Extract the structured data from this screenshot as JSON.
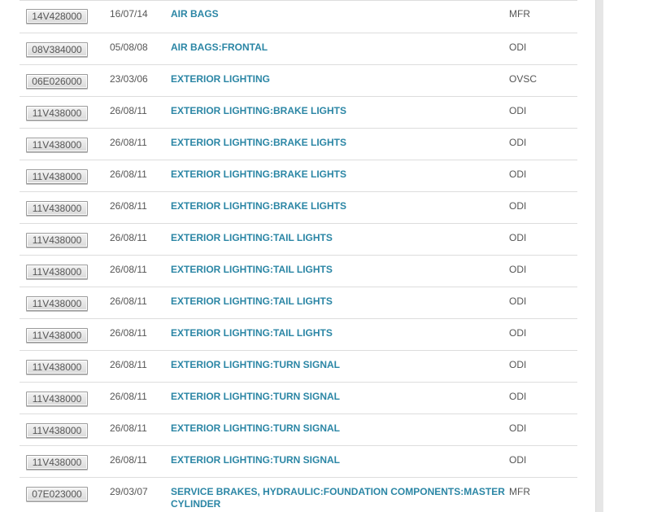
{
  "recalls": [
    {
      "id": "14V428000",
      "date": "16/07/14",
      "component": "AIR BAGS",
      "source": "MFR"
    },
    {
      "id": "08V384000",
      "date": "05/08/08",
      "component": "AIR BAGS:FRONTAL",
      "source": "ODI"
    },
    {
      "id": "06E026000",
      "date": "23/03/06",
      "component": "EXTERIOR LIGHTING",
      "source": "OVSC"
    },
    {
      "id": "11V438000",
      "date": "26/08/11",
      "component": "EXTERIOR LIGHTING:BRAKE LIGHTS",
      "source": "ODI"
    },
    {
      "id": "11V438000",
      "date": "26/08/11",
      "component": "EXTERIOR LIGHTING:BRAKE LIGHTS",
      "source": "ODI"
    },
    {
      "id": "11V438000",
      "date": "26/08/11",
      "component": "EXTERIOR LIGHTING:BRAKE LIGHTS",
      "source": "ODI"
    },
    {
      "id": "11V438000",
      "date": "26/08/11",
      "component": "EXTERIOR LIGHTING:BRAKE LIGHTS",
      "source": "ODI"
    },
    {
      "id": "11V438000",
      "date": "26/08/11",
      "component": "EXTERIOR LIGHTING:TAIL LIGHTS",
      "source": "ODI"
    },
    {
      "id": "11V438000",
      "date": "26/08/11",
      "component": "EXTERIOR LIGHTING:TAIL LIGHTS",
      "source": "ODI"
    },
    {
      "id": "11V438000",
      "date": "26/08/11",
      "component": "EXTERIOR LIGHTING:TAIL LIGHTS",
      "source": "ODI"
    },
    {
      "id": "11V438000",
      "date": "26/08/11",
      "component": "EXTERIOR LIGHTING:TAIL LIGHTS",
      "source": "ODI"
    },
    {
      "id": "11V438000",
      "date": "26/08/11",
      "component": "EXTERIOR LIGHTING:TURN SIGNAL",
      "source": "ODI"
    },
    {
      "id": "11V438000",
      "date": "26/08/11",
      "component": "EXTERIOR LIGHTING:TURN SIGNAL",
      "source": "ODI"
    },
    {
      "id": "11V438000",
      "date": "26/08/11",
      "component": "EXTERIOR LIGHTING:TURN SIGNAL",
      "source": "ODI"
    },
    {
      "id": "11V438000",
      "date": "26/08/11",
      "component": "EXTERIOR LIGHTING:TURN SIGNAL",
      "source": "ODI"
    },
    {
      "id": "07E023000",
      "date": "29/03/07",
      "component": "SERVICE BRAKES, HYDRAULIC:FOUNDATION COMPONENTS:MASTER CYLINDER",
      "source": "MFR"
    }
  ]
}
